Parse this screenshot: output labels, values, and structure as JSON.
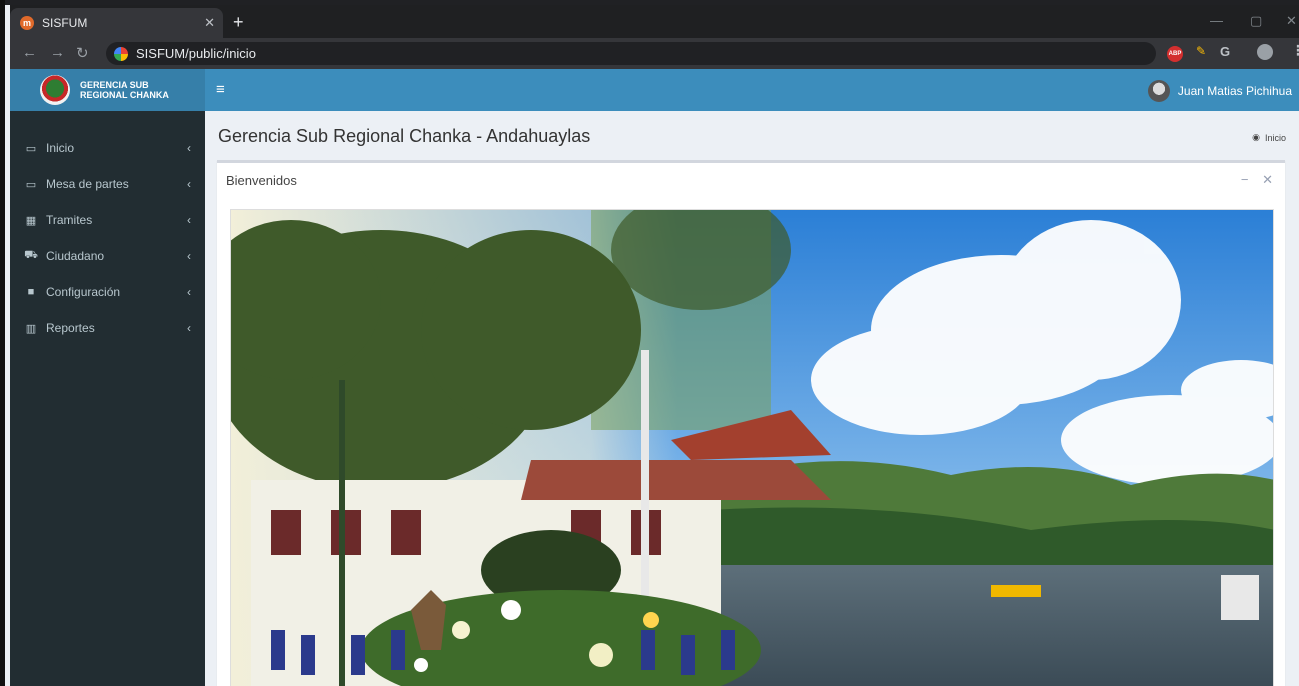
{
  "browser": {
    "tab_title": "SISFUM",
    "url": "SISFUM/public/inicio",
    "ext_abp": "ABP",
    "ext_g": "G"
  },
  "app": {
    "logo_line1": "GERENCIA SUB",
    "logo_line2": "REGIONAL CHANKA",
    "user_name": "Juan Matias Pichihua"
  },
  "sidebar": {
    "items": [
      {
        "label": "Inicio",
        "icon": "laptop-icon"
      },
      {
        "label": "Mesa de partes",
        "icon": "laptop-icon"
      },
      {
        "label": "Tramites",
        "icon": "grid-icon"
      },
      {
        "label": "Ciudadano",
        "icon": "cart-icon"
      },
      {
        "label": "Configuración",
        "icon": "folder-icon"
      },
      {
        "label": "Reportes",
        "icon": "bar-chart-icon"
      }
    ]
  },
  "content": {
    "page_title": "Gerencia Sub Regional Chanka - Andahuaylas",
    "breadcrumb": "Inicio",
    "box_title": "Bienvenidos"
  },
  "colors": {
    "navbar": "#3c8dbc",
    "logo_bg": "#367fa9",
    "sidebar_bg": "#222d32"
  }
}
